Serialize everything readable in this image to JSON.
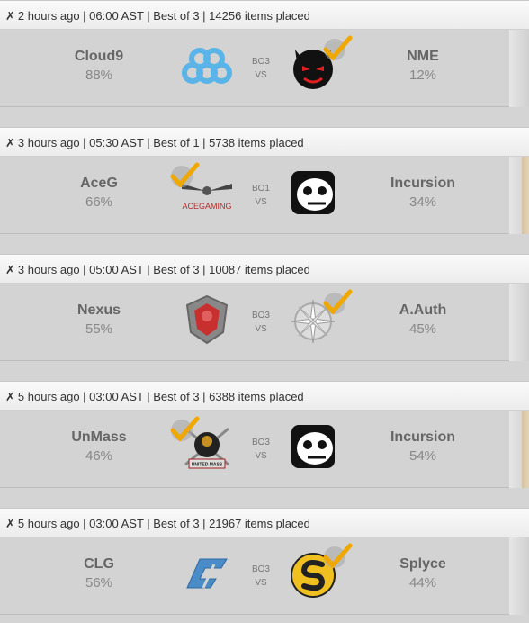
{
  "matches": [
    {
      "header": "2 hours ago | 06:00 AST | Best of 3 | 14256 items placed",
      "format": "BO3",
      "vs": "VS",
      "left": {
        "name": "Cloud9",
        "pct": "88%",
        "logo": "cloud9-logo"
      },
      "right": {
        "name": "NME",
        "pct": "12%",
        "logo": "nme-logo"
      },
      "winner": "right"
    },
    {
      "header": "3 hours ago | 05:30 AST | Best of 1 | 5738 items placed",
      "format": "BO1",
      "vs": "VS",
      "left": {
        "name": "AceG",
        "pct": "66%",
        "logo": "acegaming-logo",
        "logo_text": "ACEGAMING"
      },
      "right": {
        "name": "Incursion",
        "pct": "34%",
        "logo": "incursion-logo"
      },
      "winner": "left"
    },
    {
      "header": "3 hours ago | 05:00 AST | Best of 3 | 10087 items placed",
      "format": "BO3",
      "vs": "VS",
      "left": {
        "name": "Nexus",
        "pct": "55%",
        "logo": "nexus-logo"
      },
      "right": {
        "name": "A.Auth",
        "pct": "45%",
        "logo": "a-auth-logo"
      },
      "winner": "right"
    },
    {
      "header": "5 hours ago | 03:00 AST | Best of 3 | 6388 items placed",
      "format": "BO3",
      "vs": "VS",
      "left": {
        "name": "UnMass",
        "pct": "46%",
        "logo": "unmass-logo",
        "logo_text": "UNITED MASS"
      },
      "right": {
        "name": "Incursion",
        "pct": "54%",
        "logo": "incursion-logo"
      },
      "winner": "left"
    },
    {
      "header": "5 hours ago | 03:00 AST | Best of 3 | 21967 items placed",
      "format": "BO3",
      "vs": "VS",
      "left": {
        "name": "CLG",
        "pct": "56%",
        "logo": "clg-logo"
      },
      "right": {
        "name": "Splyce",
        "pct": "44%",
        "logo": "splyce-logo"
      },
      "winner": "right"
    }
  ],
  "icons": {
    "header_prefix": "close-x-icon",
    "winner_mark": "checkmark-icon"
  },
  "colors": {
    "checkmark": "#f0a800",
    "team_name": "#666666",
    "percent": "#888888"
  }
}
